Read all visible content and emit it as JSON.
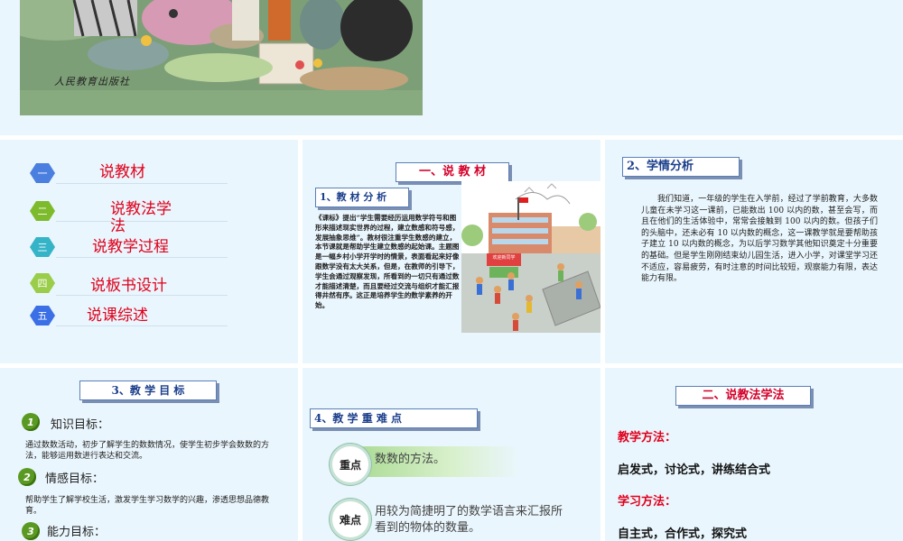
{
  "top_slide": {
    "publisher": "人民教育出版社"
  },
  "slide1": {
    "menu": [
      {
        "num": "一",
        "label": "说教材",
        "color": "#4a7fe0"
      },
      {
        "num": "二",
        "label": "说教法学\n法",
        "color": "#7dbb2c"
      },
      {
        "num": "三",
        "label": "说教学过程",
        "color": "#35b3c7"
      },
      {
        "num": "四",
        "label": "说板书设计",
        "color": "#9acd4a"
      },
      {
        "num": "五",
        "label": "说课综述",
        "color": "#3b6fe6"
      }
    ]
  },
  "slide2": {
    "title": "一、说 教 材",
    "subtitle": "1、教 材 分 析",
    "body": "《课标》提出“学生需要经历运用数学符号和图形来描述现实世界的过程，建立数感和符号感，发展抽象思维”。教材很注重学生数感的建立，本节课就是帮助学生建立数感的起始课。主题图是一幅乡村小学开学时的情景，表面看起来好像跟数学没有太大关系，但是，在教师的引导下，学生会通过观察发现，所看到的一切只有通过数才能描述清楚，而且要经过交流与组织才能汇报得井然有序。这正是培养学生的数学素养的开始。",
    "sign_text": "欢迎新同学"
  },
  "slide3": {
    "title": "2、学情分析",
    "body": "我们知道，一年级的学生在入学前，经过了学前教育，大多数儿童在未学习这一课前，已能数出 100 以内的数，甚至会写，而且在他们的生活体验中，常常会接触到 100 以内的数。但孩子们的头脑中，还未必有 10 以内数的概念，这一课教学就是要帮助孩子建立 10 以内数的概念，为以后学习数学其他知识奠定十分重要的基础。但是学生刚刚结束幼儿园生活，进入小学，对课堂学习还不适应，容易疲劳，有时注意的时间比较短，观察能力有限，表达能力有限。"
  },
  "slide4": {
    "title": "3、教 学 目 标",
    "goals": [
      {
        "num": "1",
        "label": "知识目标：",
        "desc": "通过数数活动，初步了解学生的数数情况，使学生初步学会数数的方法，能够运用数进行表达和交流。"
      },
      {
        "num": "2",
        "label": "情感目标：",
        "desc": "帮助学生了解学校生活，激发学生学习数学的兴趣，渗透思想品德教育。"
      },
      {
        "num": "3",
        "label": "能力目标：",
        "desc": ""
      }
    ]
  },
  "slide5": {
    "title": "4、教 学 重 难 点",
    "key": {
      "tag": "重点",
      "text": "数数的方法。"
    },
    "difficult": {
      "tag": "难点",
      "text": "用较为简捷明了的数学语言来汇报所看到的物体的数量。"
    }
  },
  "slide6": {
    "title": "二、说教法学法",
    "teach_label": "教学方法：",
    "teach_value": "启发式，讨论式，讲练结合式",
    "learn_label": "学习方法：",
    "learn_value": "自主式，合作式，探究式"
  }
}
